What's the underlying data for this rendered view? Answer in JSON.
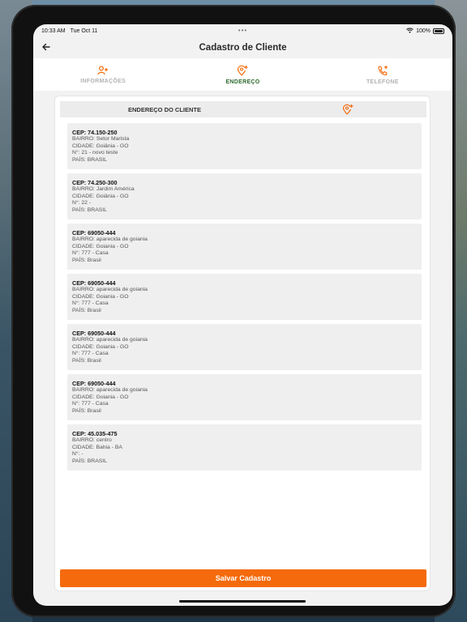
{
  "status_bar": {
    "time": "10:33 AM",
    "date": "Tue Oct 11",
    "battery": "100%"
  },
  "nav": {
    "title": "Cadastro de Cliente"
  },
  "tabs": [
    {
      "label": "INFORMAÇÕES",
      "icon": "add-user-icon",
      "active": false
    },
    {
      "label": "ENDEREÇO",
      "icon": "add-location-icon",
      "active": true
    },
    {
      "label": "TELEFONE",
      "icon": "add-phone-icon",
      "active": false
    }
  ],
  "section": {
    "title": "ENDEREÇO DO CLIENTE",
    "add_icon": "add-location-icon"
  },
  "addresses": [
    {
      "cep": "CEP: 74.150-250",
      "bairro": "BAIRRO: Setor Marista",
      "cidade": "CIDADE: Goiânia - GO",
      "numero": "N°: 21 - novo teste",
      "pais": "PAÍS: BRASIL"
    },
    {
      "cep": "CEP: 74.250-300",
      "bairro": "BAIRRO: Jardim América",
      "cidade": "CIDADE: Goiânia - GO",
      "numero": "N°: 22 -",
      "pais": "PAÍS: BRASIL"
    },
    {
      "cep": "CEP: 69050-444",
      "bairro": "BAIRRO: aparecida de goiania",
      "cidade": "CIDADE: Goiania - GO",
      "numero": "N°: 777 - Casa",
      "pais": "PAÍS: Brasil"
    },
    {
      "cep": "CEP: 69050-444",
      "bairro": "BAIRRO: aparecida de goiania",
      "cidade": "CIDADE: Goiania - GO",
      "numero": "N°: 777 - Casa",
      "pais": "PAÍS: Brasil"
    },
    {
      "cep": "CEP: 69050-444",
      "bairro": "BAIRRO: aparecida de goiania",
      "cidade": "CIDADE: Goiania - GO",
      "numero": "N°: 777 - Casa",
      "pais": "PAÍS: Brasil"
    },
    {
      "cep": "CEP: 69050-444",
      "bairro": "BAIRRO: aparecida de goiania",
      "cidade": "CIDADE: Goiania - GO",
      "numero": "N°: 777 - Casa",
      "pais": "PAÍS: Brasil"
    },
    {
      "cep": "CEP: 45.035-475",
      "bairro": "BAIRRO: centro",
      "cidade": "CIDADE: Bahia  - BA",
      "numero": "N°:  -",
      "pais": "PAÍS: BRASIL"
    }
  ],
  "save_button": {
    "label": "Salvar Cadastro"
  },
  "colors": {
    "accent": "#f56a0c",
    "active_tab": "#2e6b2e",
    "inactive_tab": "#b3b3b3"
  }
}
